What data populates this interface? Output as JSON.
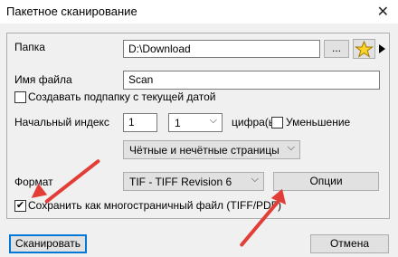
{
  "window": {
    "title": "Пакетное сканирование",
    "close_glyph": "✕"
  },
  "folder": {
    "label": "Папка",
    "value": "D:\\Download",
    "browse_label": "...",
    "favorites_icon": "star-icon",
    "play_icon": "play-icon"
  },
  "filename": {
    "label": "Имя файла",
    "value": "Scan"
  },
  "subfolder": {
    "label": "Создавать подпапку с текущей датой",
    "checked": false
  },
  "start_index": {
    "label": "Начальный индекс",
    "value": "1",
    "digits_value": "1",
    "digits_label": "цифра(ы)",
    "decrease_label": "Уменьшение",
    "decrease_checked": false
  },
  "pages": {
    "value": "Чётные и нечётные страницы"
  },
  "format": {
    "label": "Формат",
    "value": "TIF - TIFF Revision 6",
    "options_label": "Опции"
  },
  "multipage": {
    "label": "Сохранить как многостраничный файл (TIFF/PDF)",
    "checked": true,
    "check_glyph": "✔"
  },
  "footer": {
    "scan_label": "Сканировать",
    "cancel_label": "Отмена"
  },
  "colors": {
    "arrow": "#e23d36",
    "focus": "#0078d7"
  }
}
